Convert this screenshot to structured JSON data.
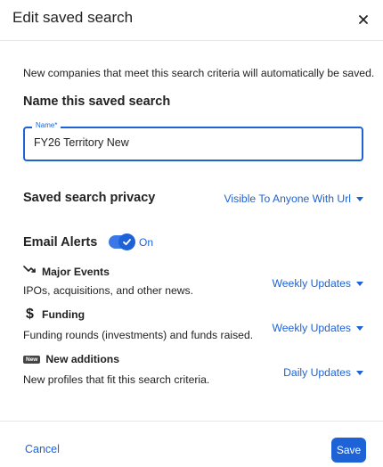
{
  "dialog": {
    "title": "Edit saved search",
    "intro": "New companies that meet this search criteria will automatically be saved."
  },
  "name_section": {
    "title": "Name this saved search",
    "field_label": "Name*",
    "field_value": "FY26 Territory New"
  },
  "privacy": {
    "title": "Saved search privacy",
    "value": "Visible To Anyone With Url"
  },
  "email_alerts": {
    "title": "Email Alerts",
    "toggle_label": "On",
    "toggle_on": true,
    "items": [
      {
        "name": "Major Events",
        "icon": "trending-arrow-icon",
        "description": "IPOs, acquisitions, and other news.",
        "frequency": "Weekly Updates"
      },
      {
        "name": "Funding",
        "icon": "dollar-icon",
        "description": "Funding rounds (investments) and funds raised.",
        "frequency": "Weekly Updates"
      },
      {
        "name": "New additions",
        "icon": "new-badge-icon",
        "badge_text": "New",
        "description": "New profiles that fit this search criteria.",
        "frequency": "Daily Updates"
      }
    ]
  },
  "footer": {
    "cancel_label": "Cancel",
    "save_label": "Save"
  },
  "colors": {
    "accent": "#1d62d6",
    "text": "#222222",
    "divider": "#e6e6e6"
  }
}
